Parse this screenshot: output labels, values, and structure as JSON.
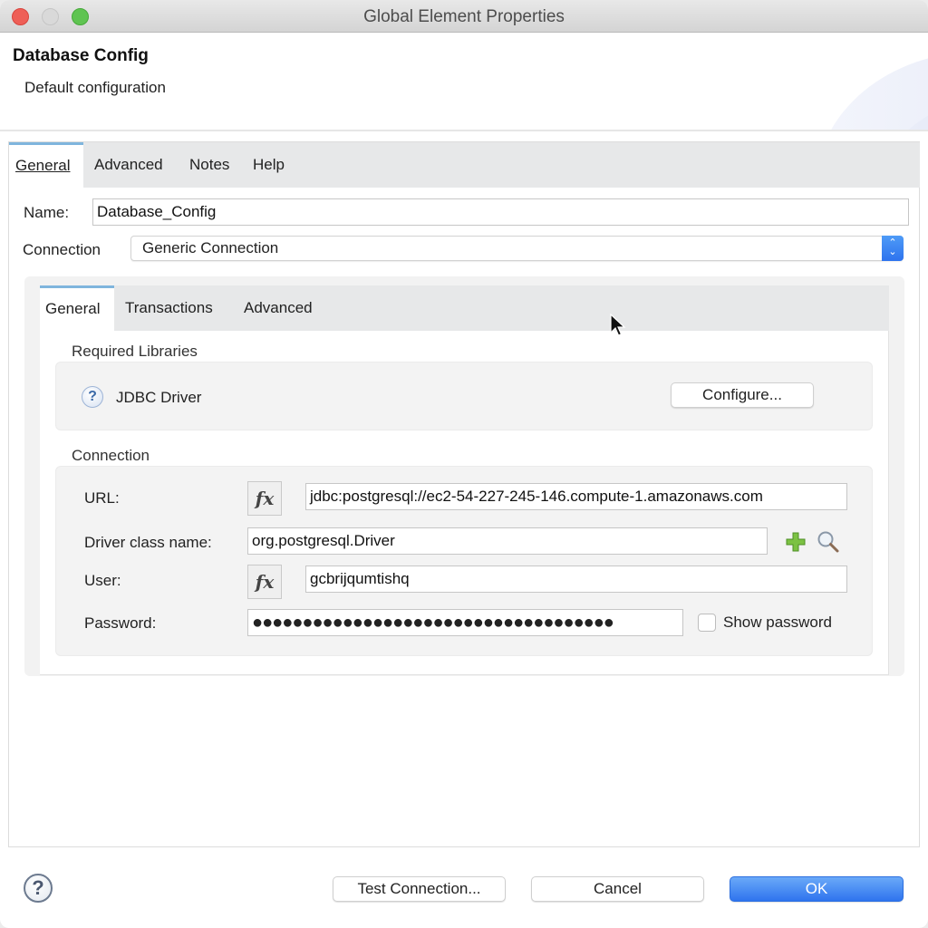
{
  "window": {
    "title": "Global Element Properties"
  },
  "header": {
    "title": "Database Config",
    "subtitle": "Default configuration"
  },
  "outer_tabs": [
    {
      "label": "General",
      "active": true
    },
    {
      "label": "Advanced",
      "active": false
    },
    {
      "label": "Notes",
      "active": false
    },
    {
      "label": "Help",
      "active": false
    }
  ],
  "form": {
    "name_label": "Name:",
    "name_value": "Database_Config",
    "connection_label": "Connection",
    "connection_value": "Generic Connection"
  },
  "inner_tabs": [
    {
      "label": "General",
      "active": true
    },
    {
      "label": "Transactions",
      "active": false
    },
    {
      "label": "Advanced",
      "active": false
    }
  ],
  "required_libraries": {
    "section_label": "Required Libraries",
    "item_label": "JDBC Driver",
    "configure_button": "Configure..."
  },
  "connection_section": {
    "section_label": "Connection",
    "url_label": "URL:",
    "url_value": "jdbc:postgresql://ec2-54-227-245-146.compute-1.amazonaws.com",
    "driver_label": "Driver class name:",
    "driver_value": "org.postgresql.Driver",
    "user_label": "User:",
    "user_value": "gcbrijqumtishq",
    "password_label": "Password:",
    "password_mask": "●●●●●●●●●●●●●●●●●●●●●●●●●●●●●●●●●●●●",
    "show_password_label": "Show password",
    "show_password_checked": false,
    "fx_symbol": "fx"
  },
  "footer": {
    "test_connection": "Test Connection...",
    "cancel": "Cancel",
    "ok": "OK"
  },
  "icons": {
    "help_glyph": "?",
    "stepper_up": "⌃",
    "stepper_down": "⌄"
  },
  "colors": {
    "accent": "#2f74ee",
    "tab_indicator": "#7fb5dd",
    "close": "#ee5f57",
    "maximize": "#5fc451",
    "plus": "#7cc243"
  }
}
